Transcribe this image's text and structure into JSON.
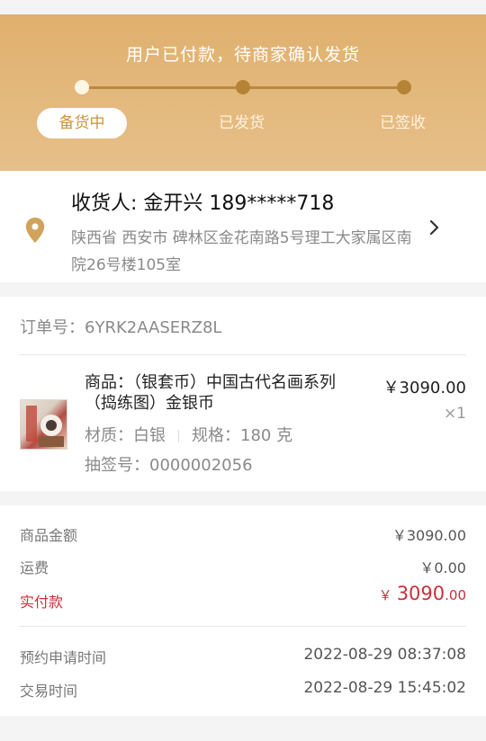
{
  "status": {
    "title": "用户已付款，待商家确认发货",
    "steps": [
      "备货中",
      "已发货",
      "已签收"
    ],
    "active_step": 0
  },
  "address": {
    "consignee": "收货人: 金开兴 189*****718",
    "detail": "陕西省 西安市 碑林区金花南路5号理工大家属区南院26号楼105室"
  },
  "order": {
    "order_no": "订单号：6YRK2AASERZ8L",
    "product_name": "商品：（银套币）中国古代名画系列（捣练图）金银币",
    "material": "材质：白银",
    "spec": "规格：180 克",
    "lottery_no": "抽签号：0000002056",
    "price": "￥3090.00",
    "quantity": "×1"
  },
  "summary": {
    "goods_amount_label": "商品金额",
    "goods_amount": "￥3090.00",
    "shipping_label": "运费",
    "shipping": "￥0.00",
    "paid_label": "实付款",
    "paid_symbol": "￥",
    "paid_int": "3090",
    "paid_dec": ".00",
    "reserve_time_label": "预约申请时间",
    "reserve_time": "2022-08-29 08:37:08",
    "trade_time_label": "交易时间",
    "trade_time": "2022-08-29 15:45:02"
  },
  "colors": {
    "header": "#e2b574",
    "accent": "#c8933e",
    "paid": "#c8313b"
  },
  "icons": [
    "location-pin-icon",
    "chevron-right-icon"
  ]
}
